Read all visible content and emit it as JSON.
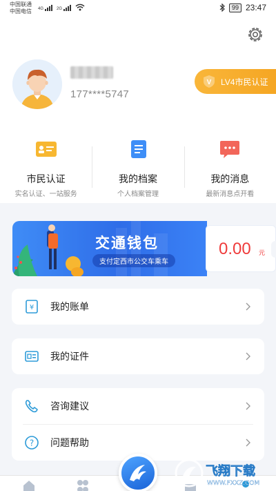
{
  "status_bar": {
    "carrier1": "中国联通",
    "carrier2": "中国电信",
    "net1": "4G",
    "net2": "2G",
    "battery": "99",
    "time": "23:47"
  },
  "profile": {
    "phone": "177****5747",
    "level_badge": "LV4市民认证",
    "badge_icon_letter": "V"
  },
  "quick_actions": [
    {
      "title": "市民认证",
      "subtitle": "实名认证、一站服务",
      "icon": "id-card-icon"
    },
    {
      "title": "我的档案",
      "subtitle": "个人档案管理",
      "icon": "document-icon"
    },
    {
      "title": "我的消息",
      "subtitle": "最新消息点开看",
      "icon": "message-icon"
    }
  ],
  "wallet": {
    "title": "交通钱包",
    "subtitle": "支付定西市公交车乘车",
    "amount": "0.00",
    "unit": "元"
  },
  "menu": {
    "bill": "我的账单",
    "certificates": "我的证件",
    "consult": "咨询建议",
    "help": "问题帮助"
  },
  "watermark": {
    "text1": "飞翔下载",
    "text2": "WWW.FXXZ.COM"
  },
  "colors": {
    "accent_orange": "#f5a623",
    "wallet_blue": "#2f6de8",
    "amount_red": "#ef3b3b",
    "icon_blue": "#2d9bd8"
  }
}
